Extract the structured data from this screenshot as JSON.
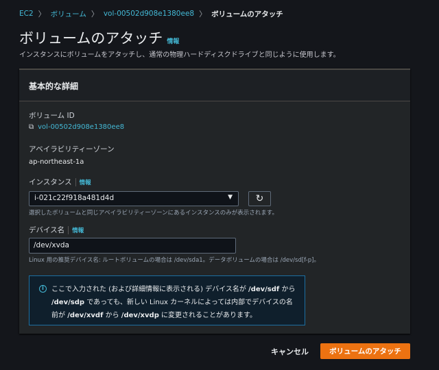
{
  "breadcrumb": {
    "items": [
      "EC2",
      "ボリューム",
      "vol-00502d908e1380ee8"
    ],
    "current": "ボリュームのアタッチ"
  },
  "page": {
    "title": "ボリュームのアタッチ",
    "info": "情報",
    "description": "インスタンスにボリュームをアタッチし、通常の物理ハードディスクドライブと同じように使用します。"
  },
  "panel": {
    "title": "基本的な詳細",
    "volume_id_label": "ボリューム ID",
    "volume_id": "vol-00502d908e1380ee8",
    "az_label": "アベイラビリティーゾーン",
    "az": "ap-northeast-1a",
    "instance_label": "インスタンス",
    "instance_info": "情報",
    "instance_value": "i-021c22f918a481d4d",
    "instance_hint": "選択したボリュームと同じアベイラビリティーゾーンにあるインスタンスのみが表示されます。",
    "device_label": "デバイス名",
    "device_info": "情報",
    "device_value": "/dev/xvda",
    "device_hint": "Linux 用の推奨デバイス名: ルートボリュームの場合は /dev/sda1。データボリュームの場合は /dev/sd[f-p]。",
    "alert": {
      "t1": "ここで入力された (および詳細情報に表示される) デバイス名が ",
      "b1": "/dev/sdf",
      "t2": " から ",
      "b2": "/dev/sdp",
      "t3": " であっても、新しい Linux カーネルによっては内部でデバイスの名前が ",
      "b3": "/dev/xvdf",
      "t4": " から ",
      "b4": "/dev/xvdp",
      "t5": " に変更されることがあります。"
    }
  },
  "footer": {
    "cancel": "キャンセル",
    "attach": "ボリュームのアタッチ"
  }
}
